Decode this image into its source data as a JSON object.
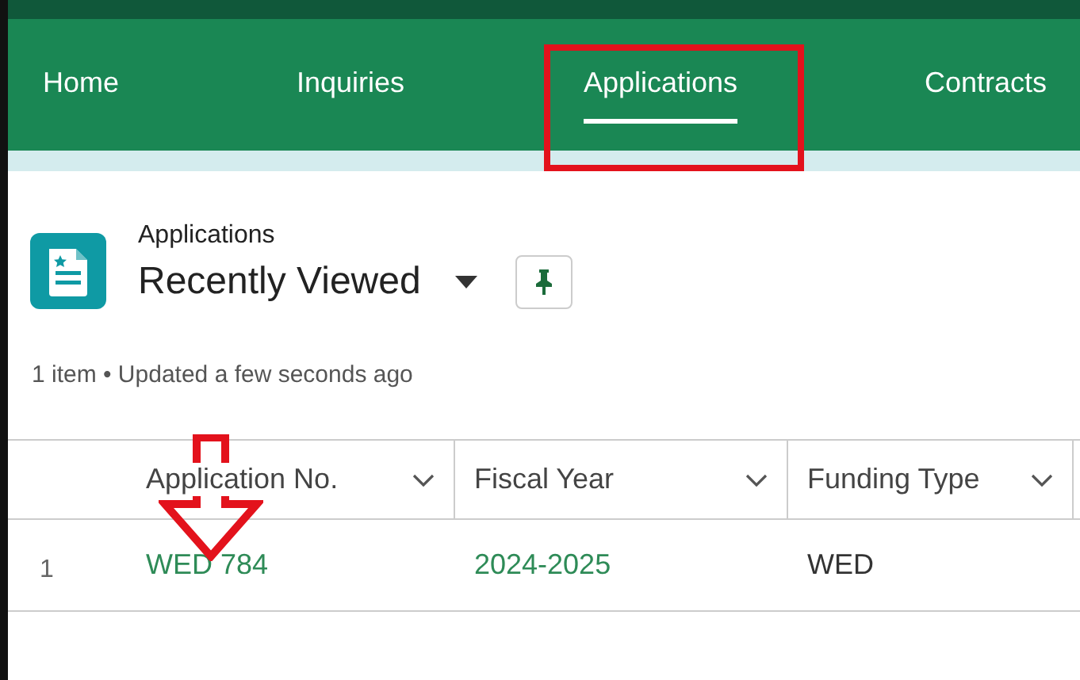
{
  "nav_tabs": [
    {
      "label": "Home",
      "selected": false
    },
    {
      "label": "Inquiries",
      "selected": false
    },
    {
      "label": "Applications",
      "selected": true
    },
    {
      "label": "Contracts",
      "selected": false
    }
  ],
  "list_header": {
    "object_label": "Applications",
    "view_name": "Recently Viewed",
    "status": "1 item • Updated a few seconds ago"
  },
  "table": {
    "columns": [
      "Application No.",
      "Fiscal Year",
      "Funding Type"
    ],
    "rows": [
      {
        "row_number": "1",
        "cells": [
          {
            "text": "WED 784",
            "kind": "link"
          },
          {
            "text": "2024-2025",
            "kind": "link"
          },
          {
            "text": "WED",
            "kind": "text"
          }
        ]
      }
    ]
  },
  "annotations": {
    "highlight_box": true,
    "arrow": true
  }
}
